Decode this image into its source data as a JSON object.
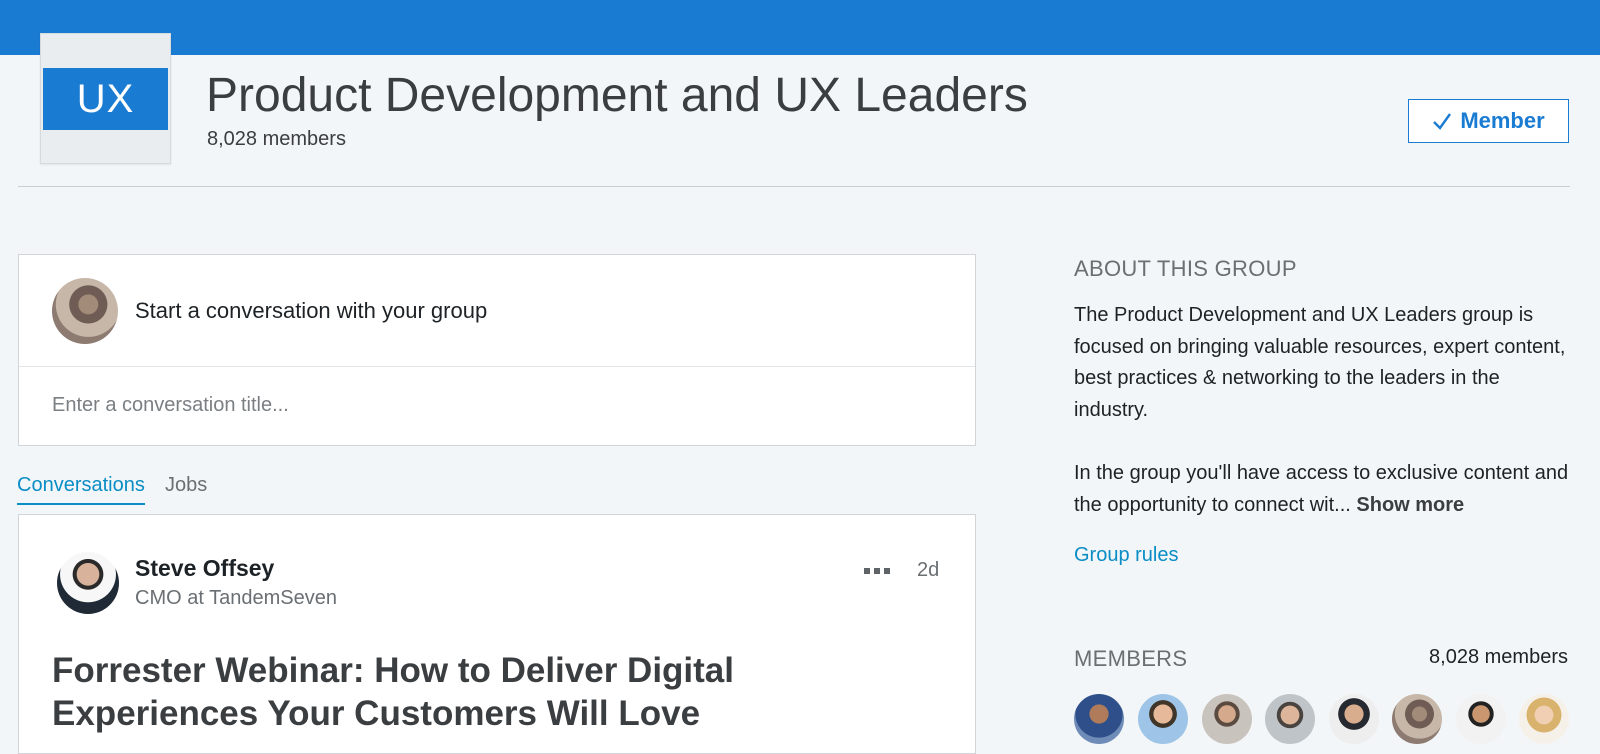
{
  "group": {
    "logo_text": "UX",
    "title": "Product Development and UX Leaders",
    "members": "8,028 members",
    "member_button": "Member"
  },
  "composer": {
    "prompt": "Start a conversation with your group",
    "title_placeholder": "Enter a conversation title..."
  },
  "tabs": [
    {
      "label": "Conversations",
      "active": true
    },
    {
      "label": "Jobs",
      "active": false
    }
  ],
  "post": {
    "author": "Steve Offsey",
    "author_title": "CMO at TandemSeven",
    "age": "2d",
    "title": "Forrester Webinar: How to Deliver Digital Experiences Your Customers Will Love"
  },
  "about": {
    "heading": "ABOUT THIS GROUP",
    "paragraph1": "The Product Development and UX Leaders group is focused on bringing valuable resources, expert content, best practices & networking to the leaders in the industry.",
    "paragraph2": "In the group you'll have access to exclusive content and the opportunity to connect wit...",
    "show_more": "Show more",
    "group_rules": "Group rules"
  },
  "members_section": {
    "heading": "MEMBERS",
    "count": "8,028 members",
    "avatar_count": 8
  },
  "colors": {
    "brand_blue": "#1a7bd3",
    "link_blue": "#0a8dc5",
    "page_bg": "#f3f6f8"
  }
}
